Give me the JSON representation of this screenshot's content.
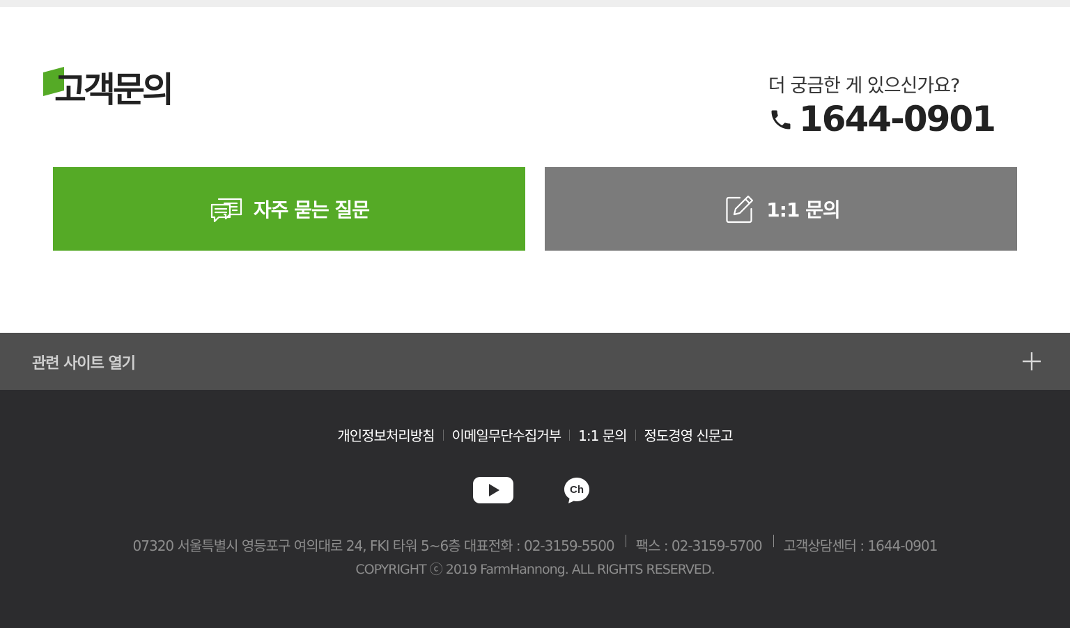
{
  "page": {
    "title": "고객문의",
    "brand_color": "#55aa26"
  },
  "contact": {
    "question": "더 궁금한 게 있으신가요?",
    "phone": "1644-0901",
    "phone_icon": "phone-icon"
  },
  "buttons": {
    "faq": {
      "label": "자주 묻는 질문",
      "icon": "chat-bubbles-icon",
      "color": "#55aa26"
    },
    "qna": {
      "label": "1:1 문의",
      "icon": "edit-icon",
      "color": "#7b7b7b"
    }
  },
  "related_sites": {
    "label": "관련 사이트 열기",
    "icon": "plus-icon"
  },
  "footer": {
    "links": [
      "개인정보처리방침",
      "이메일무단수집거부",
      "1:1 문의",
      "정도경영 신문고"
    ],
    "social": [
      {
        "name": "youtube",
        "icon": "youtube-icon"
      },
      {
        "name": "kakao-channel",
        "icon": "kakao-channel-icon",
        "text": "Ch"
      }
    ],
    "address": "07320 서울특별시 영등포구 여의대로 24, FKI 타워 5~6층  대표전화 : 02-3159-5500",
    "fax": "팩스 : 02-3159-5700",
    "cs_center": "고객상담센터 : 1644-0901",
    "copyright": "COPYRIGHT ⓒ 2019 FarmHannong. ALL RIGHTS RESERVED."
  }
}
